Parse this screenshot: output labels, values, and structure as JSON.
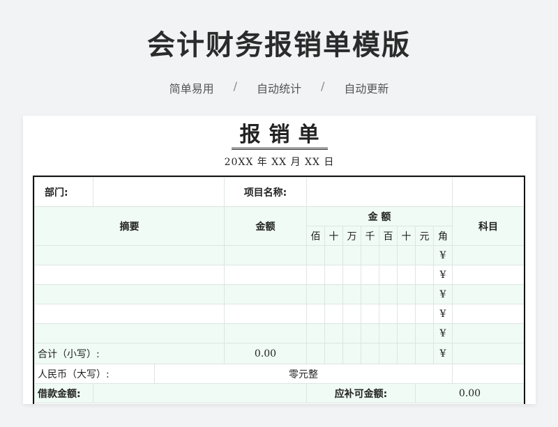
{
  "header": {
    "title": "会计财务报销单模版",
    "tags": [
      "简单易用",
      "自动统计",
      "自动更新"
    ],
    "separator": "/"
  },
  "document": {
    "title": "报销单",
    "date_line": "20XX 年 XX 月 XX 日",
    "department_label": "部门:",
    "department_value": "",
    "project_label": "项目名称:",
    "project_value": "",
    "col_summary": "摘要",
    "col_amount": "金额",
    "col_amount_group": "金 额",
    "digit_labels": [
      "佰",
      "十",
      "万",
      "千",
      "百",
      "十",
      "元",
      "角"
    ],
    "col_subject": "科目",
    "rows": [
      {
        "summary": "",
        "amount": "",
        "yen": "¥",
        "subject": ""
      },
      {
        "summary": "",
        "amount": "",
        "yen": "¥",
        "subject": ""
      },
      {
        "summary": "",
        "amount": "",
        "yen": "¥",
        "subject": ""
      },
      {
        "summary": "",
        "amount": "",
        "yen": "¥",
        "subject": ""
      },
      {
        "summary": "",
        "amount": "",
        "yen": "¥",
        "subject": ""
      }
    ],
    "total_label": "合计（小写）:",
    "total_value": "0.00",
    "total_yen": "¥",
    "rmb_label": "人民币（大写）:",
    "rmb_value": "零元整",
    "loan_label": "借款金额:",
    "loan_value": "",
    "refund_label": "应补可金额:",
    "refund_value": "0.00"
  },
  "colors": {
    "background": "#f2f3f5",
    "row_tint": "#effbf4",
    "border": "#dde6e1",
    "frame": "#111111"
  }
}
